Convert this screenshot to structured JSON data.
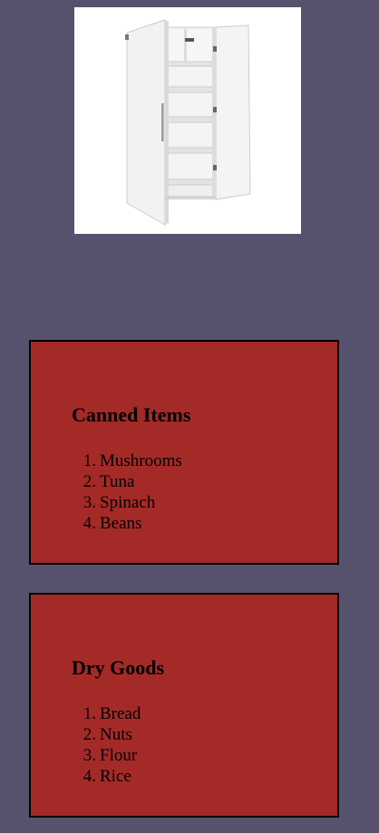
{
  "hero": {
    "icon": "storage-cabinet-icon"
  },
  "sections": [
    {
      "title": "Canned Items",
      "items": [
        "Mushrooms",
        "Tuna",
        "Spinach",
        "Beans"
      ]
    },
    {
      "title": "Dry Goods",
      "items": [
        "Bread",
        "Nuts",
        "Flour",
        "Rice"
      ]
    }
  ],
  "colors": {
    "background": "#56526e",
    "card": "#a42a27",
    "border": "#000000"
  }
}
